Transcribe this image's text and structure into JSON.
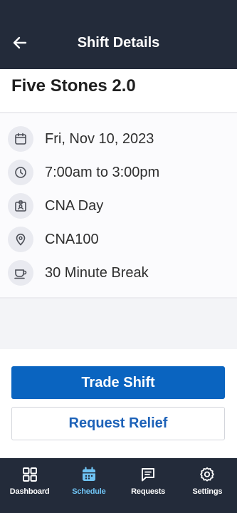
{
  "header": {
    "title": "Shift Details",
    "back_icon": "arrow-left-icon"
  },
  "shift": {
    "name": "Five Stones 2.0",
    "details": [
      {
        "icon": "calendar-icon",
        "text": "Fri, Nov 10, 2023"
      },
      {
        "icon": "clock-icon",
        "text": "7:00am to 3:00pm"
      },
      {
        "icon": "badge-icon",
        "text": "CNA Day"
      },
      {
        "icon": "location-pin-icon",
        "text": "CNA100"
      },
      {
        "icon": "coffee-cup-icon",
        "text": "30 Minute Break"
      }
    ]
  },
  "actions": {
    "trade_label": "Trade Shift",
    "relief_label": "Request Relief"
  },
  "nav": {
    "items": [
      {
        "label": "Dashboard",
        "icon": "dashboard-icon",
        "active": false
      },
      {
        "label": "Schedule",
        "icon": "calendar-icon",
        "active": true
      },
      {
        "label": "Requests",
        "icon": "message-icon",
        "active": false
      },
      {
        "label": "Settings",
        "icon": "gear-icon",
        "active": false
      }
    ]
  },
  "colors": {
    "nav_bg": "#232b3a",
    "primary": "#0a64c0",
    "active_nav": "#6fc3f3",
    "icon_bg": "#e9eaf0"
  }
}
